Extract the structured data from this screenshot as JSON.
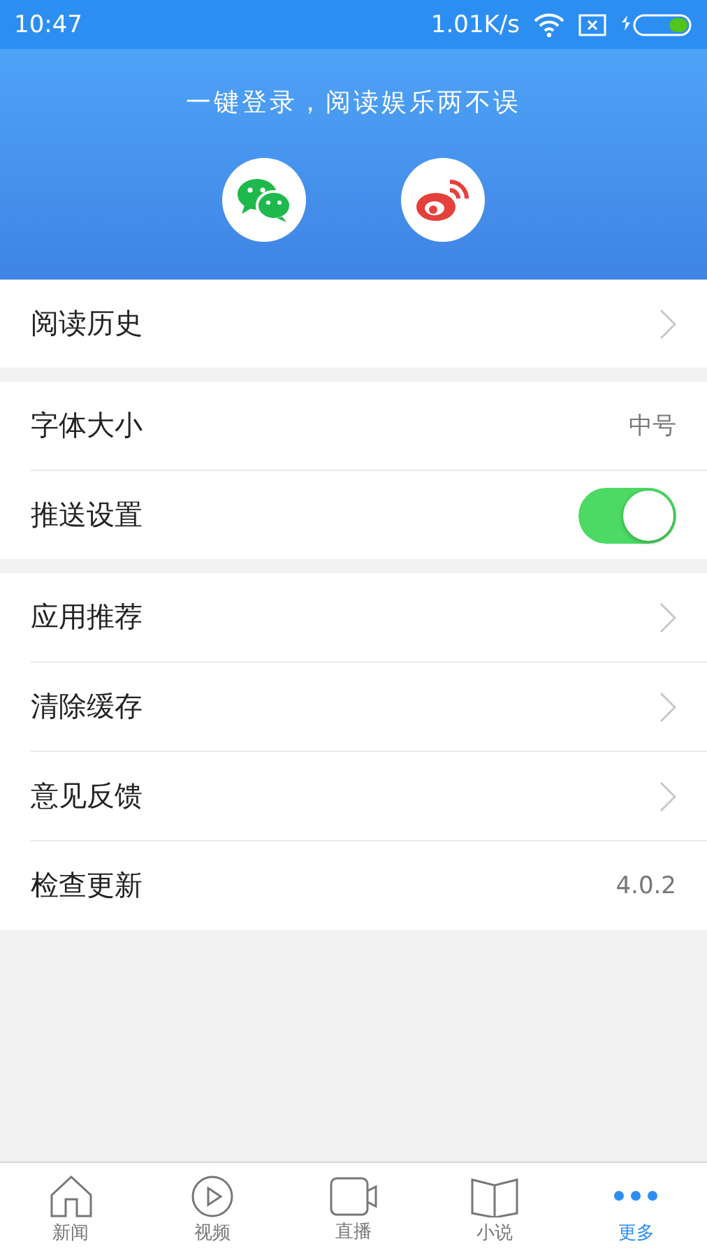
{
  "status_bar": {
    "time": "10:47",
    "speed": "1.01K/s"
  },
  "login": {
    "slogan": "一键登录，阅读娱乐两不误",
    "providers": [
      {
        "kind": "chat"
      },
      {
        "kind": "weibo"
      }
    ]
  },
  "groups": [
    {
      "rows": [
        {
          "kind": "arrow",
          "label": "阅读历史"
        }
      ]
    },
    {
      "rows": [
        {
          "kind": "value",
          "label": "字体大小",
          "value": "中号"
        },
        {
          "kind": "toggle",
          "label": "推送设置",
          "on": true
        }
      ]
    },
    {
      "rows": [
        {
          "kind": "arrow",
          "label": "应用推荐"
        },
        {
          "kind": "arrow",
          "label": "清除缓存"
        },
        {
          "kind": "arrow",
          "label": "意见反馈"
        },
        {
          "kind": "value",
          "label": "检查更新",
          "value": "4.0.2"
        }
      ]
    }
  ],
  "tab_bar": [
    {
      "kind": "home",
      "label": "新闻",
      "selected": false
    },
    {
      "kind": "play",
      "label": "视频",
      "selected": false
    },
    {
      "kind": "camera",
      "label": "直播",
      "selected": false
    },
    {
      "kind": "book",
      "label": "小说",
      "selected": false
    },
    {
      "kind": "more",
      "label": "更多",
      "selected": true
    }
  ]
}
